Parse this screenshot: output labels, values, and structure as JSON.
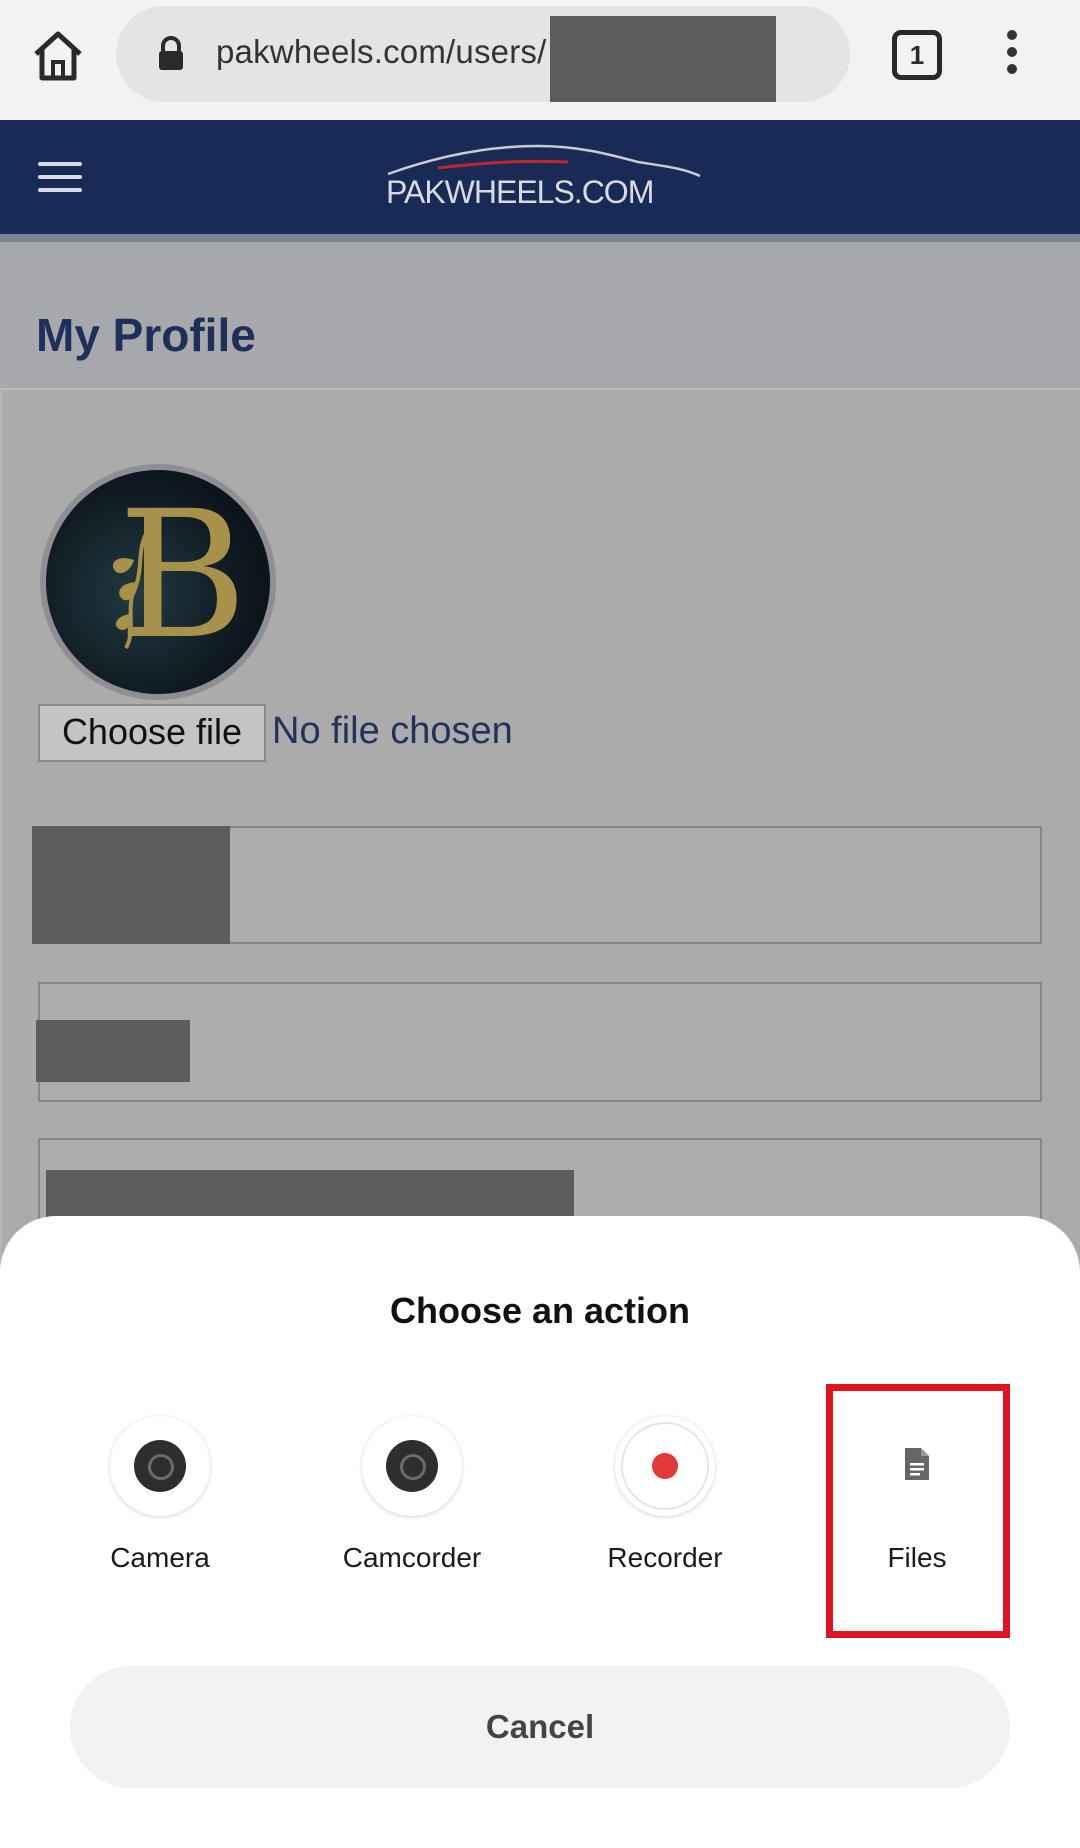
{
  "browser": {
    "url": "pakwheels.com/users/",
    "tab_count": "1"
  },
  "site": {
    "logo_text": "PAKWHEELS.COM"
  },
  "profile": {
    "page_title": "My Profile",
    "avatar_letter": "B",
    "choose_file_label": "Choose file",
    "no_file_text": "No file chosen"
  },
  "sheet": {
    "title": "Choose an action",
    "actions": [
      {
        "label": "Camera",
        "icon": "camera-icon"
      },
      {
        "label": "Camcorder",
        "icon": "camcorder-icon"
      },
      {
        "label": "Recorder",
        "icon": "recorder-icon"
      },
      {
        "label": "Files",
        "icon": "document-icon"
      }
    ],
    "cancel_label": "Cancel"
  },
  "colors": {
    "header": "#182a55",
    "title": "#1e3059",
    "highlight": "#e0141e",
    "record": "#e23838"
  }
}
